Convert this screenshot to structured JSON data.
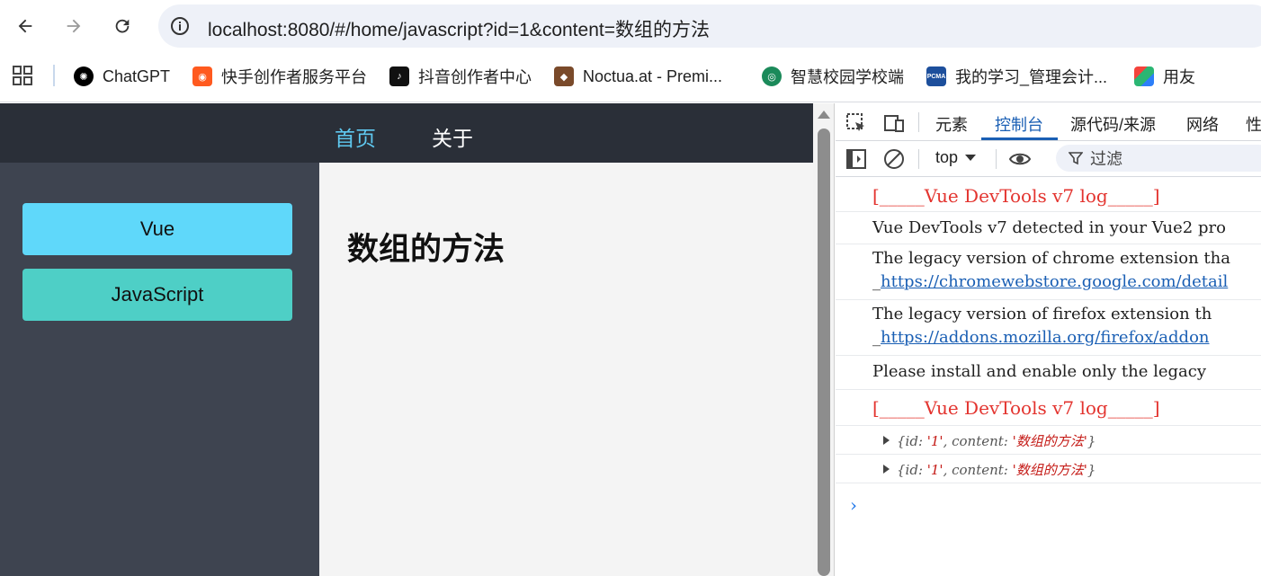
{
  "browser": {
    "url": "localhost:8080/#/home/javascript?id=1&content=数组的方法"
  },
  "bookmarks": [
    {
      "label": "ChatGPT",
      "icon": "chatgpt-icon"
    },
    {
      "label": "快手创作者服务平台",
      "icon": "kuaishou-icon"
    },
    {
      "label": "抖音创作者中心",
      "icon": "douyin-icon"
    },
    {
      "label": "Noctua.at - Premi...",
      "icon": "noctua-icon"
    },
    {
      "label": "智慧校园学校端",
      "icon": "campus-icon"
    },
    {
      "label": "我的学习_管理会计...",
      "icon": "pcma-icon"
    },
    {
      "label": "用友",
      "icon": "yonyou-icon"
    }
  ],
  "app": {
    "nav": {
      "home": "首页",
      "about": "关于"
    },
    "sidebar": {
      "vue": "Vue",
      "javascript": "JavaScript"
    },
    "content_title": "数组的方法"
  },
  "devtools": {
    "tabs": [
      "元素",
      "控制台",
      "源代码/来源",
      "网络",
      "性"
    ],
    "context": "top",
    "filter_placeholder": "过滤",
    "console": {
      "log1": "[_____Vue DevTools v7 log_____]",
      "log2": "Vue DevTools v7 detected in your Vue2 pro",
      "log3": "The legacy version of chrome extension tha",
      "log3_link": "https://chromewebstore.google.com/detail",
      "log4": "The legacy version of firefox extension th",
      "log4_link": "https://addons.mozilla.org/firefox/addon",
      "log5": "Please install and enable only the legacy",
      "log6": "[_____Vue DevTools v7 log_____]",
      "obj": {
        "open": "{id: ",
        "id_val": "'1'",
        "mid": ", content: ",
        "content_val": "'数组的方法'",
        "close": "}"
      }
    },
    "prompt": "›"
  },
  "colors": {
    "header_bg": "#2a2f38",
    "sidebar_bg": "#3e4450",
    "nav_active": "#5fc8ef",
    "vue_btn": "#5fd8fa",
    "js_btn": "#4ecfc6",
    "devtools_accent": "#1a5fb4",
    "console_red": "#e3342f"
  }
}
